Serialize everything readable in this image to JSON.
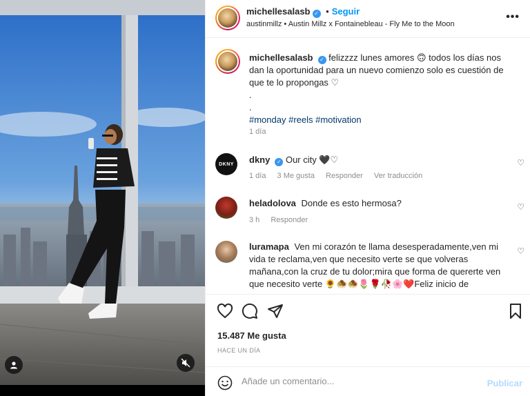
{
  "header": {
    "username": "michellesalasb",
    "separator": "•",
    "follow_label": "Seguir",
    "song": "austinmillz • Austin Millz x Fontainebleau - Fly Me to the Moon",
    "more": "•••"
  },
  "caption": {
    "username": "michellesalasb",
    "text": "felizzzz lunes amores 🙃 todos los días nos dan la oportunidad para un nuevo comienzo solo es cuestión de que te lo propongas ♡",
    "dot1": ".",
    "dot2": ".",
    "hashtags": "#monday #reels #motivation",
    "time": "1 día"
  },
  "comments": [
    {
      "username": "dkny",
      "avatar_text": "DKNY",
      "text": "Our city 🖤♡",
      "time": "1 día",
      "likes": "3 Me gusta",
      "reply": "Responder",
      "translate": "Ver traducción"
    },
    {
      "username": "heladolova",
      "text": "Donde es esto hermosa?",
      "time": "3 h",
      "reply": "Responder"
    },
    {
      "username": "luramapa",
      "text": "Ven mi corazón te llama desesperadamente,ven mi vida te reclama,ven que necesito verte se que volveras mañana,con la cruz de tu dolor;mira que forma de quererte ven que necesito verte 🌻🧆🧆🌷🌹🥀🌸❤️Feliz inicio de"
    }
  ],
  "actions": {
    "likes": "15.487 Me gusta",
    "date": "HACE UN DÍA"
  },
  "add_comment": {
    "placeholder": "Añade un comentario...",
    "publish": "Publicar"
  }
}
